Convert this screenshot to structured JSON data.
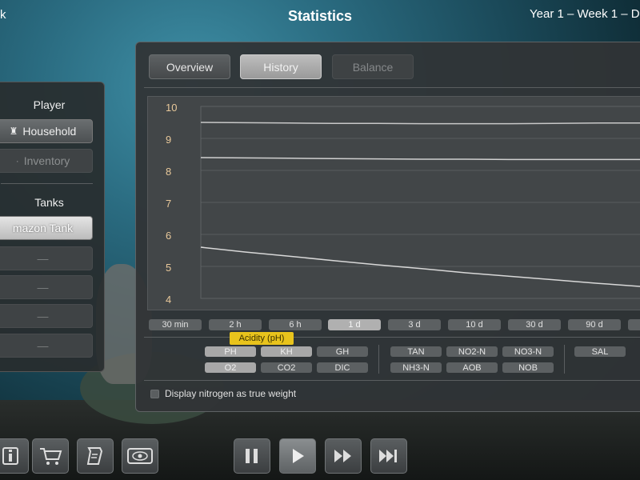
{
  "topbar": {
    "left_text": "k",
    "title": "Statistics",
    "date": "Year 1 – Week 1 – D"
  },
  "left_panel": {
    "player_heading": "Player",
    "household_label": "Household",
    "inventory_label": "Inventory",
    "tanks_heading": "Tanks",
    "tank_selected": "mazon Tank",
    "tank_slots": [
      "—",
      "—",
      "—",
      "—"
    ]
  },
  "tabs": {
    "overview": "Overview",
    "history": "History",
    "balance": "Balance"
  },
  "chart_data": {
    "type": "line",
    "y_ticks": [
      "10",
      "9",
      "8",
      "7",
      "6",
      "5",
      "4"
    ],
    "ylim": [
      4,
      10
    ],
    "x": [
      0,
      0.1,
      0.2,
      0.3,
      0.4,
      0.5,
      0.6,
      0.7,
      0.8,
      0.9,
      1.0
    ],
    "series": [
      {
        "values": [
          9.5,
          9.49,
          9.48,
          9.47,
          9.47,
          9.46,
          9.46,
          9.46,
          9.47,
          9.48,
          9.48
        ],
        "color": "#c8c8c8"
      },
      {
        "values": [
          8.4,
          8.39,
          8.38,
          8.37,
          8.36,
          8.35,
          8.35,
          8.34,
          8.34,
          8.34,
          8.34
        ],
        "color": "#d0d0d0"
      },
      {
        "values": [
          5.6,
          5.45,
          5.32,
          5.18,
          5.05,
          4.93,
          4.8,
          4.69,
          4.58,
          4.47,
          4.37
        ],
        "color": "#d8d8d8"
      }
    ],
    "grid": true
  },
  "time_ranges": [
    "30 min",
    "2 h",
    "6 h",
    "1 d",
    "3 d",
    "10 d",
    "30 d",
    "90 d"
  ],
  "selected_range": "1 d",
  "params": {
    "group1_row1": [
      "PH",
      "KH",
      "GH"
    ],
    "group1_row2": [
      "O2",
      "CO2",
      "DIC"
    ],
    "group2_row1": [
      "TAN",
      "NO2-N",
      "NO3-N"
    ],
    "group2_row2": [
      "NH3-N",
      "AOB",
      "NOB"
    ],
    "group3_row1": [
      "SAL"
    ]
  },
  "tooltip": "Acidity (pH)",
  "checkbox_label": "Display nitrogen as true weight",
  "toolbar_icons": [
    "info-icon",
    "cart-icon",
    "scroll-icon",
    "eye-icon",
    "pause-icon",
    "play-icon",
    "fast-forward-icon",
    "skip-forward-icon"
  ]
}
